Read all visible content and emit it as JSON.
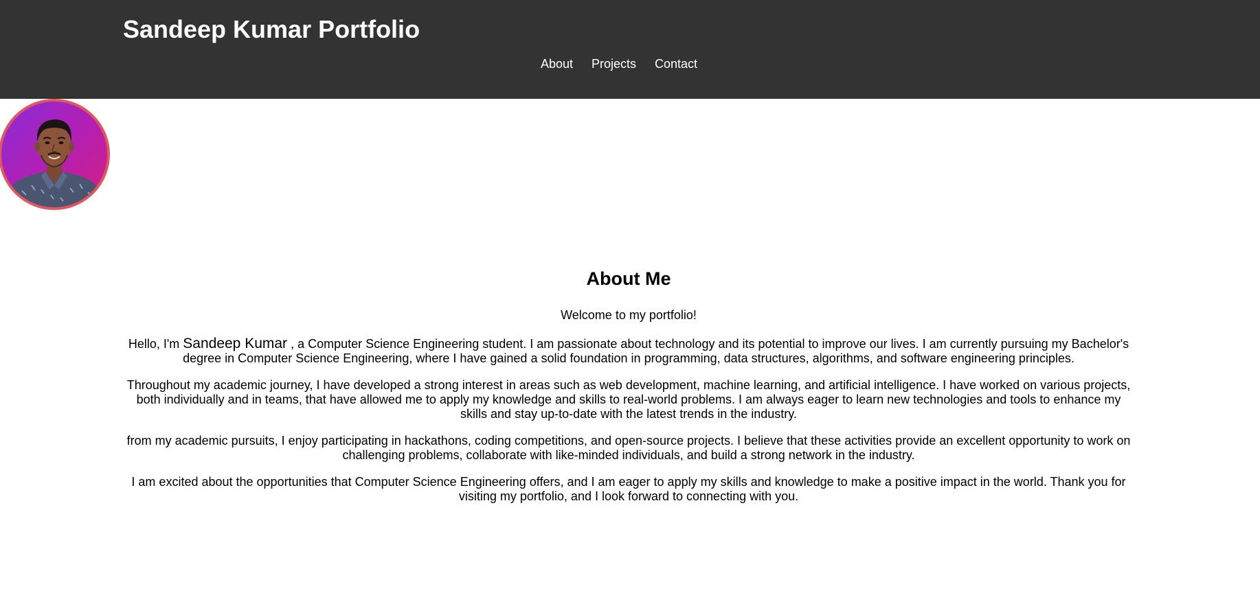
{
  "header": {
    "title": "Sandeep Kumar Portfolio",
    "nav": [
      {
        "label": "About"
      },
      {
        "label": "Projects"
      },
      {
        "label": "Contact"
      }
    ],
    "background_color": "#333333"
  },
  "profile": {
    "avatar_icon": "profile-photo",
    "border_color": "#e0575f"
  },
  "about": {
    "heading": "About Me",
    "welcome": "Welcome to my portfolio!",
    "intro_prefix": "Hello, I'm ",
    "intro_name": "Sandeep Kumar",
    "intro_suffix": " , a Computer Science Engineering student. I am passionate about technology and its potential to improve our lives. I am currently pursuing my Bachelor's degree in Computer Science Engineering, where I have gained a solid foundation in programming, data structures, algorithms, and software engineering principles.",
    "paragraph_2": "Throughout my academic journey, I have developed a strong interest in areas such as web development, machine learning, and artificial intelligence. I have worked on various projects, both individually and in teams, that have allowed me to apply my knowledge and skills to real-world problems. I am always eager to learn new technologies and tools to enhance my skills and stay up-to-date with the latest trends in the industry.",
    "paragraph_3": "from my academic pursuits, I enjoy participating in hackathons, coding competitions, and open-source projects. I believe that these activities provide an excellent opportunity to work on challenging problems, collaborate with like-minded individuals, and build a strong network in the industry.",
    "paragraph_4": "I am excited about the opportunities that Computer Science Engineering offers, and I am eager to apply my skills and knowledge to make a positive impact in the world. Thank you for visiting my portfolio, and I look forward to connecting with you."
  }
}
